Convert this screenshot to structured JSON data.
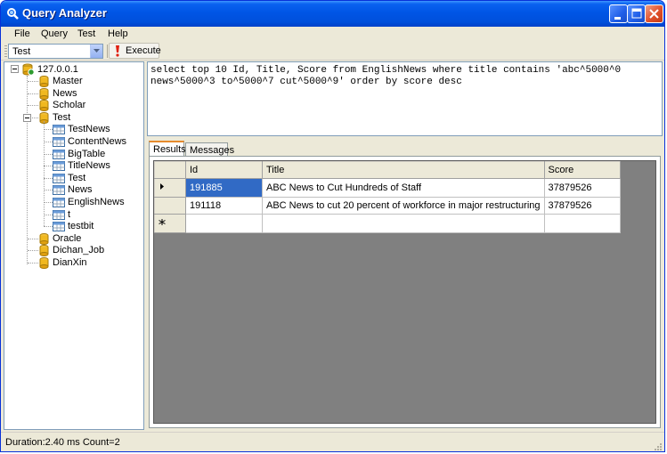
{
  "window": {
    "title": "Query Analyzer"
  },
  "menu": {
    "items": [
      "File",
      "Query",
      "Test",
      "Help"
    ]
  },
  "toolbar": {
    "database_selected": "Test",
    "execute_label": "Execute"
  },
  "tree": {
    "root": "127.0.0.1",
    "databases": [
      {
        "name": "Master"
      },
      {
        "name": "News"
      },
      {
        "name": "Scholar"
      },
      {
        "name": "Test",
        "expanded": true,
        "tables": [
          "TestNews",
          "ContentNews",
          "BigTable",
          "TitleNews",
          "Test",
          "News",
          "EnglishNews",
          "t",
          "testbit"
        ]
      },
      {
        "name": "Oracle"
      },
      {
        "name": "Dichan_Job"
      },
      {
        "name": "DianXin"
      }
    ]
  },
  "query": {
    "text": "select top 10 Id, Title, Score from EnglishNews where title contains 'abc^5000^0 news^5000^3 to^5000^7 cut^5000^9' order by score desc"
  },
  "tabs": [
    {
      "label": "Results",
      "active": true
    },
    {
      "label": "Messages",
      "active": false
    }
  ],
  "results": {
    "columns": [
      "Id",
      "Title",
      "Score"
    ],
    "rows": [
      [
        "191885",
        "ABC News to Cut Hundreds of Staff",
        "37879526"
      ],
      [
        "191118",
        "ABC News to cut 20 percent of workforce in major restructuring",
        "37879526"
      ]
    ]
  },
  "status": {
    "text": "Duration:2.40 ms Count=2"
  },
  "colors": {
    "title_bar": "#0055e5",
    "selection": "#316ac5",
    "grid_background": "#808080",
    "tab_accent": "#e68b2c"
  }
}
